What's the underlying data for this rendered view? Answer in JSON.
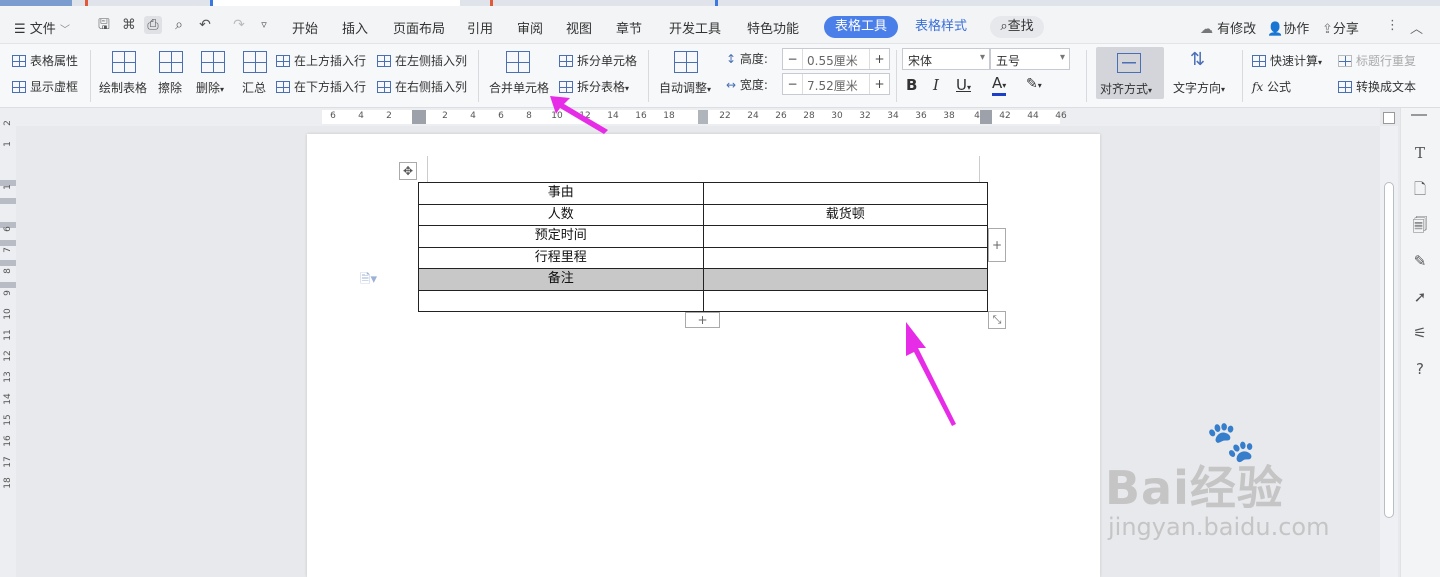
{
  "menubar": {
    "file_label": "文件",
    "tabs": [
      "开始",
      "插入",
      "页面布局",
      "引用",
      "审阅",
      "视图",
      "章节",
      "开发工具",
      "特色功能"
    ],
    "table_tools_label": "表格工具",
    "table_style_label": "表格样式",
    "search_label": "查找",
    "modified_label": "有修改",
    "collab_label": "协作",
    "share_label": "分享",
    "accent_color": "#4a7ee8"
  },
  "ribbon": {
    "table_props": "表格属性",
    "show_gridlines": "显示虚框",
    "draw_table": "绘制表格",
    "erase": "擦除",
    "delete": "删除",
    "summary": "汇总",
    "insert_row_above": "在上方插入行",
    "insert_row_below": "在下方插入行",
    "insert_col_left": "在左侧插入列",
    "insert_col_right": "在右侧插入列",
    "merge_cells": "合并单元格",
    "split_cells": "拆分单元格",
    "split_table": "拆分表格",
    "auto_fit": "自动调整",
    "height_label": "高度:",
    "height_value": "0.55厘米",
    "width_label": "宽度:",
    "width_value": "7.52厘米",
    "font_name": "宋体",
    "font_size": "五号",
    "bold": "B",
    "italic": "I",
    "underline": "U",
    "font_color_glyph": "A",
    "align": "对齐方式",
    "text_dir": "文字方向",
    "quick_calc": "快速计算",
    "repeat_title": "标题行重复",
    "formula": "公式",
    "to_text": "转换成文本"
  },
  "ruler": {
    "ticks": [
      "6",
      "4",
      "2",
      "",
      "2",
      "4",
      "6",
      "8",
      "10",
      "12",
      "14",
      "16",
      "18",
      "",
      "22",
      "24",
      "26",
      "28",
      "30",
      "32",
      "34",
      "36",
      "38",
      "4",
      "42",
      "44",
      "46"
    ],
    "vticks": [
      "2",
      "1",
      "",
      "1",
      "",
      "6",
      "7",
      "8",
      "9",
      "10",
      "11",
      "12",
      "13",
      "14",
      "15",
      "16",
      "17",
      "18"
    ]
  },
  "table": {
    "rows": [
      [
        "事由",
        ""
      ],
      [
        "人数",
        "载货顿"
      ],
      [
        "预定时间",
        ""
      ],
      [
        "行程里程",
        ""
      ],
      [
        "备注",
        ""
      ],
      [
        "",
        ""
      ]
    ]
  },
  "watermark": {
    "brand": "Bai经验",
    "url": "jingyan.baidu.com"
  }
}
